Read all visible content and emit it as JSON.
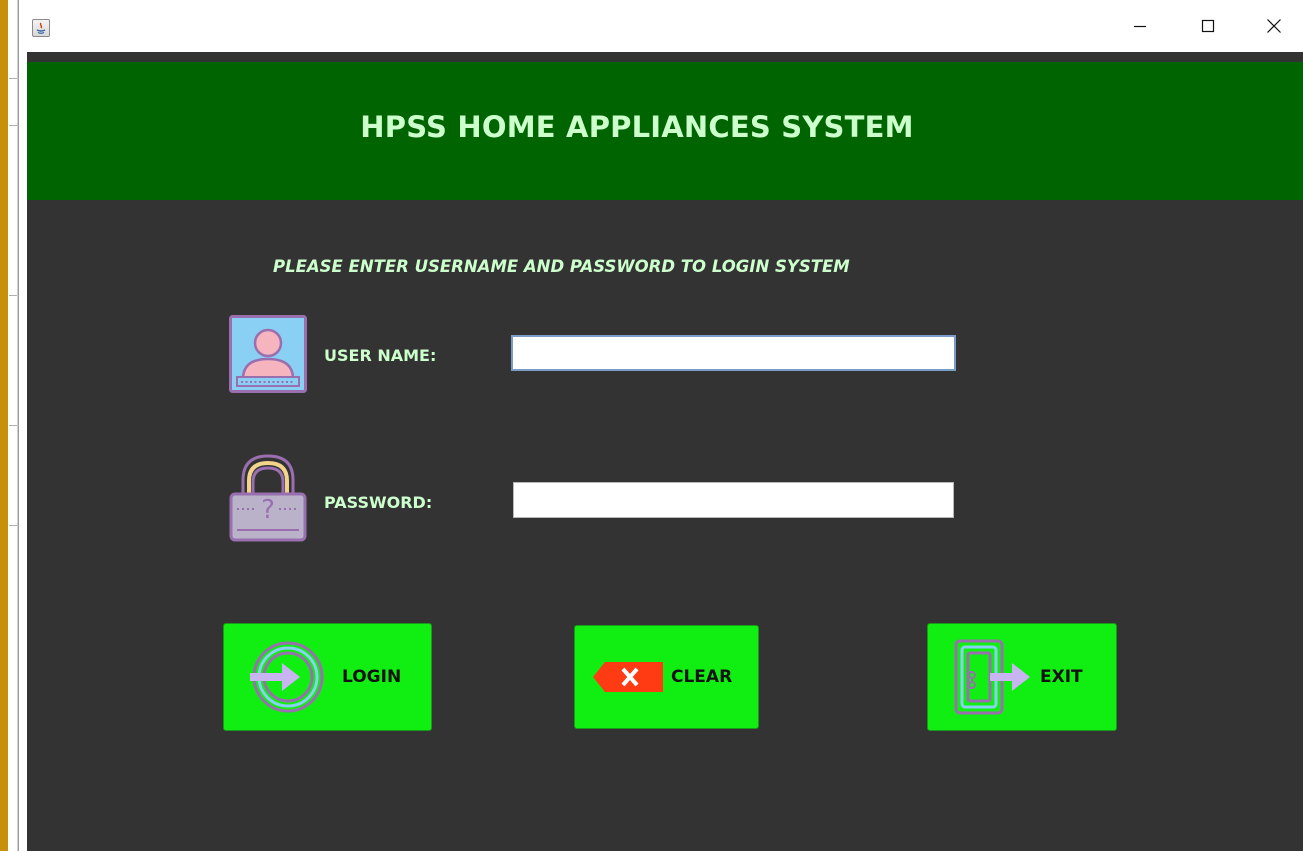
{
  "window": {
    "title": "",
    "controls": {
      "minimize": "minimize-icon",
      "maximize": "maximize-icon",
      "close": "close-icon"
    }
  },
  "header": {
    "title": "HPSS HOME APPLIANCES SYSTEM"
  },
  "login": {
    "instruction": "PLEASE ENTER USERNAME AND PASSWORD TO LOGIN SYSTEM",
    "username_label": "USER NAME:",
    "username_value": "",
    "password_label": "PASSWORD:",
    "password_value": ""
  },
  "buttons": {
    "login_label": "LOGIN",
    "clear_label": "CLEAR",
    "exit_label": "EXIT"
  },
  "icons": {
    "user": "user-icon",
    "lock": "lock-icon",
    "login": "login-icon",
    "clear": "clear-icon",
    "exit": "exit-door-icon"
  },
  "colors": {
    "header_bg": "#006400",
    "panel_bg": "#333333",
    "label_text": "#ccffcc",
    "button_bg": "#11ee11"
  }
}
